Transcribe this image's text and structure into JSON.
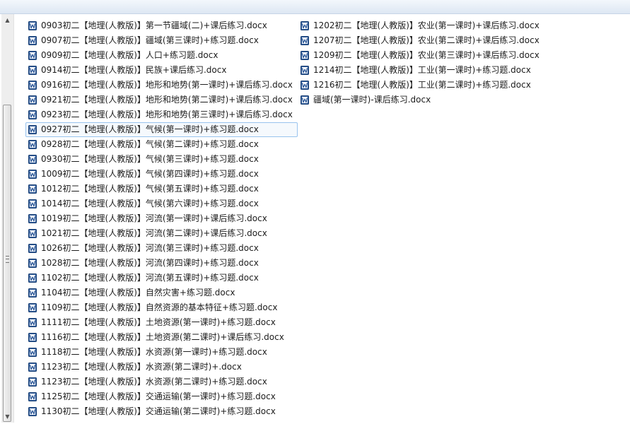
{
  "icons": {
    "file": "word-document-icon",
    "scroll_up": "scroll-up-arrow-icon",
    "scroll_down": "scroll-down-arrow-icon",
    "glyph_up": "▲",
    "glyph_down": "▼"
  },
  "colors": {
    "word_icon": "#2b5797",
    "selection_border": "#99c3ee"
  },
  "files": {
    "column1": [
      "0903初二【地理(人教版)】第一节疆域(二)+课后练习.docx",
      "0907初二【地理(人教版)】疆域(第三课时)+练习题.docx",
      "0909初二【地理(人教版)】人口+练习题.docx",
      "0914初二【地理(人教版)】民族+课后练习.docx",
      "0916初二【地理(人教版)】地形和地势(第一课时)+课后练习.docx",
      "0921初二【地理(人教版)】地形和地势(第二课时)+课后练习.docx",
      "0923初二【地理(人教版)】地形和地势(第三课时)+课后练习.docx",
      "0927初二【地理(人教版)】气候(第一课时)+练习题.docx",
      "0928初二【地理(人教版)】气候(第二课时)+练习题.docx",
      "0930初二【地理(人教版)】气候(第三课时)+练习题.docx",
      "1009初二【地理(人教版)】气候(第四课时)+练习题.docx",
      "1012初二【地理(人教版)】气候(第五课时)+练习题.docx",
      "1014初二【地理(人教版)】气候(第六课时)+练习题.docx",
      "1019初二【地理(人教版)】河流(第一课时)+课后练习.docx",
      "1021初二【地理(人教版)】河流(第二课时)+课后练习.docx",
      "1026初二【地理(人教版)】河流(第三课时)+练习题.docx",
      "1028初二【地理(人教版)】河流(第四课时)+练习题.docx",
      "1102初二【地理(人教版)】河流(第五课时)+练习题.docx",
      "1104初二【地理(人教版)】自然灾害+练习题.docx",
      "1109初二【地理(人教版)】自然资源的基本特征+练习题.docx",
      "1111初二【地理(人教版)】土地资源(第一课时)+练习题.docx",
      "1116初二【地理(人教版)】土地资源(第二课时)+课后练习.docx",
      "1118初二【地理(人教版)】水资源(第一课时)+练习题.docx",
      "1123初二【地理(人教版)】水资源(第二课时)+.docx",
      "1123初二【地理(人教版)】水资源(第二课时)+练习题.docx",
      "1125初二【地理(人教版)】交通运输(第一课时)+练习题.docx",
      "1130初二【地理(人教版)】交通运输(第二课时)+练习题.docx"
    ],
    "column2": [
      "1202初二【地理(人教版)】农业(第一课时)+课后练习.docx",
      "1207初二【地理(人教版)】农业(第二课时)+课后练习.docx",
      "1209初二【地理(人教版)】农业(第三课时)+课后练习.docx",
      "1214初二【地理(人教版)】工业(第一课时)+练习题.docx",
      "1216初二【地理(人教版)】工业(第二课时)+练习题.docx",
      "疆域(第一课时)-课后练习.docx"
    ],
    "selected": "0927初二【地理(人教版)】气候(第一课时)+练习题.docx"
  }
}
